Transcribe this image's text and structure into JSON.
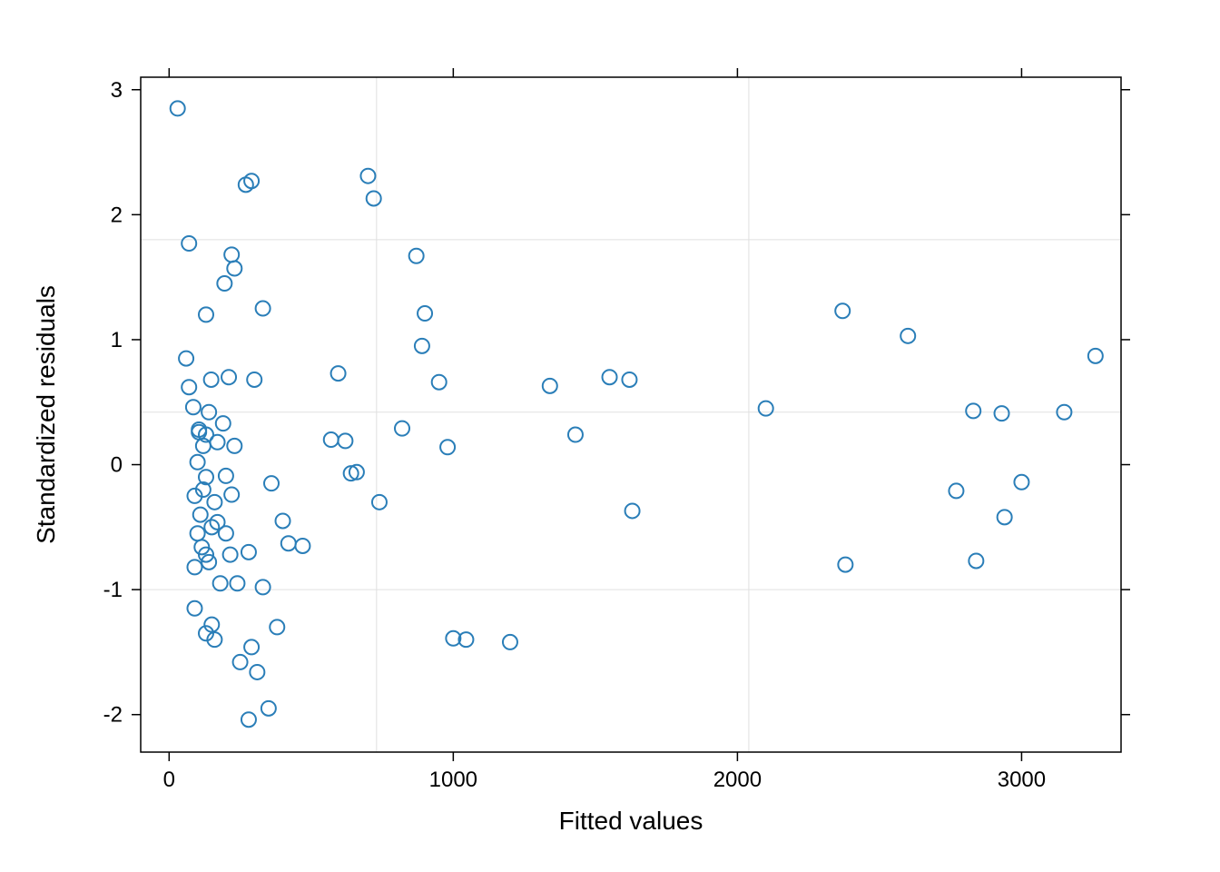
{
  "chart_data": {
    "type": "scatter",
    "xlabel": "Fitted values",
    "ylabel": "Standardized residuals",
    "xlim": [
      -100,
      3350
    ],
    "ylim": [
      -2.3,
      3.1
    ],
    "xticks": [
      0,
      1000,
      2000,
      3000
    ],
    "yticks": [
      -2,
      -1,
      0,
      1,
      2,
      3
    ],
    "grid": true,
    "points": [
      {
        "x": 30,
        "y": 2.85
      },
      {
        "x": 60,
        "y": 0.85
      },
      {
        "x": 70,
        "y": 1.77
      },
      {
        "x": 70,
        "y": 0.62
      },
      {
        "x": 85,
        "y": 0.46
      },
      {
        "x": 90,
        "y": -0.25
      },
      {
        "x": 90,
        "y": -0.82
      },
      {
        "x": 90,
        "y": -1.15
      },
      {
        "x": 100,
        "y": 0.02
      },
      {
        "x": 100,
        "y": -0.55
      },
      {
        "x": 105,
        "y": 0.26
      },
      {
        "x": 105,
        "y": 0.28
      },
      {
        "x": 110,
        "y": -0.4
      },
      {
        "x": 115,
        "y": -0.66
      },
      {
        "x": 120,
        "y": 0.15
      },
      {
        "x": 120,
        "y": -0.2
      },
      {
        "x": 130,
        "y": 0.24
      },
      {
        "x": 130,
        "y": -0.1
      },
      {
        "x": 130,
        "y": 1.2
      },
      {
        "x": 130,
        "y": -0.72
      },
      {
        "x": 130,
        "y": -1.35
      },
      {
        "x": 140,
        "y": 0.42
      },
      {
        "x": 140,
        "y": -0.78
      },
      {
        "x": 148,
        "y": 0.68
      },
      {
        "x": 150,
        "y": -0.5
      },
      {
        "x": 150,
        "y": -1.28
      },
      {
        "x": 160,
        "y": -0.3
      },
      {
        "x": 160,
        "y": -1.4
      },
      {
        "x": 170,
        "y": 0.18
      },
      {
        "x": 170,
        "y": -0.46
      },
      {
        "x": 180,
        "y": -0.95
      },
      {
        "x": 190,
        "y": 0.33
      },
      {
        "x": 195,
        "y": 1.45
      },
      {
        "x": 200,
        "y": -0.09
      },
      {
        "x": 200,
        "y": -0.55
      },
      {
        "x": 210,
        "y": 0.7
      },
      {
        "x": 215,
        "y": -0.72
      },
      {
        "x": 220,
        "y": 1.68
      },
      {
        "x": 220,
        "y": -0.24
      },
      {
        "x": 230,
        "y": 1.57
      },
      {
        "x": 230,
        "y": 0.15
      },
      {
        "x": 240,
        "y": -0.95
      },
      {
        "x": 250,
        "y": -1.58
      },
      {
        "x": 270,
        "y": 2.24
      },
      {
        "x": 280,
        "y": -0.7
      },
      {
        "x": 280,
        "y": -2.04
      },
      {
        "x": 290,
        "y": 2.27
      },
      {
        "x": 290,
        "y": -1.46
      },
      {
        "x": 300,
        "y": 0.68
      },
      {
        "x": 310,
        "y": -1.66
      },
      {
        "x": 330,
        "y": 1.25
      },
      {
        "x": 330,
        "y": -0.98
      },
      {
        "x": 350,
        "y": -1.95
      },
      {
        "x": 360,
        "y": -0.15
      },
      {
        "x": 380,
        "y": -1.3
      },
      {
        "x": 400,
        "y": -0.45
      },
      {
        "x": 420,
        "y": -0.63
      },
      {
        "x": 470,
        "y": -0.65
      },
      {
        "x": 570,
        "y": 0.2
      },
      {
        "x": 595,
        "y": 0.73
      },
      {
        "x": 620,
        "y": 0.19
      },
      {
        "x": 640,
        "y": -0.07
      },
      {
        "x": 660,
        "y": -0.06
      },
      {
        "x": 700,
        "y": 2.31
      },
      {
        "x": 720,
        "y": 2.13
      },
      {
        "x": 740,
        "y": -0.3
      },
      {
        "x": 820,
        "y": 0.29
      },
      {
        "x": 870,
        "y": 1.67
      },
      {
        "x": 890,
        "y": 0.95
      },
      {
        "x": 900,
        "y": 1.21
      },
      {
        "x": 950,
        "y": 0.66
      },
      {
        "x": 980,
        "y": 0.14
      },
      {
        "x": 1000,
        "y": -1.39
      },
      {
        "x": 1045,
        "y": -1.4
      },
      {
        "x": 1200,
        "y": -1.42
      },
      {
        "x": 1340,
        "y": 0.63
      },
      {
        "x": 1430,
        "y": 0.24
      },
      {
        "x": 1550,
        "y": 0.7
      },
      {
        "x": 1620,
        "y": 0.68
      },
      {
        "x": 1630,
        "y": -0.37
      },
      {
        "x": 2100,
        "y": 0.45
      },
      {
        "x": 2370,
        "y": 1.23
      },
      {
        "x": 2380,
        "y": -0.8
      },
      {
        "x": 2600,
        "y": 1.03
      },
      {
        "x": 2770,
        "y": -0.21
      },
      {
        "x": 2830,
        "y": 0.43
      },
      {
        "x": 2840,
        "y": -0.77
      },
      {
        "x": 2930,
        "y": 0.41
      },
      {
        "x": 2940,
        "y": -0.42
      },
      {
        "x": 3000,
        "y": -0.14
      },
      {
        "x": 3150,
        "y": 0.42
      },
      {
        "x": 3260,
        "y": 0.87
      }
    ]
  }
}
